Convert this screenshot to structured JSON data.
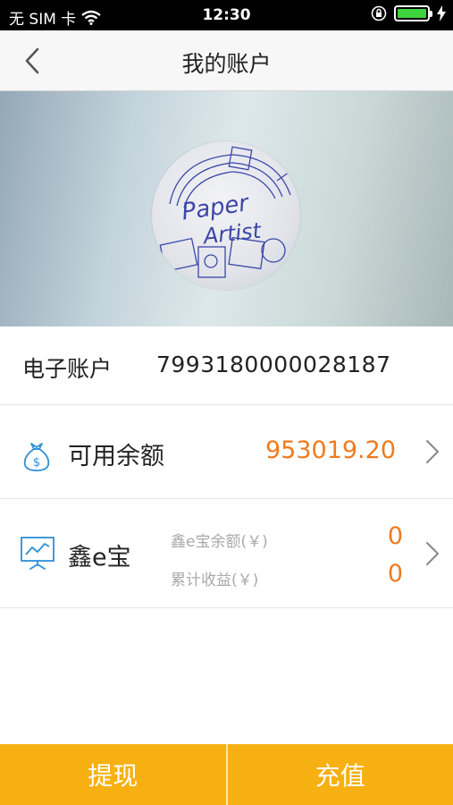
{
  "status_bar": {
    "carrier": "无 SIM 卡",
    "time": "12:30"
  },
  "nav": {
    "title": "我的账户"
  },
  "account": {
    "label": "电子账户",
    "number": "7993180000028187"
  },
  "balance": {
    "label": "可用余额",
    "value": "953019.20"
  },
  "xinebao": {
    "label": "鑫e宝",
    "balance_label": "鑫e宝余额(￥)",
    "balance_value": "0",
    "income_label": "累计收益(￥)",
    "income_value": "0"
  },
  "actions": {
    "withdraw": "提现",
    "recharge": "充值"
  },
  "colors": {
    "accent_orange": "#f07a1e",
    "bottom_bar": "#f6b012"
  }
}
